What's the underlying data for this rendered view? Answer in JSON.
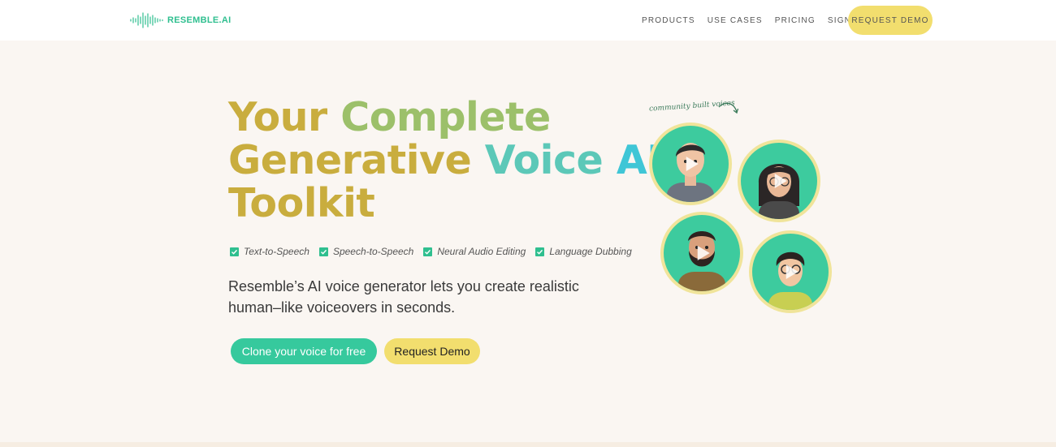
{
  "nav": {
    "logo_text": "RESEMBLE.AI",
    "links": [
      "PRODUCTS",
      "USE CASES",
      "PRICING",
      "SIGN IN"
    ],
    "cta": "REQUEST DEMO"
  },
  "hero": {
    "title_line1_a": "Your",
    "title_line1_b": "Complete",
    "title_line2_a": "Generative",
    "title_line2_b": "Voice",
    "title_line2_c": "AI",
    "title_line3": "Toolkit",
    "features": [
      "Text-to-Speech",
      "Speech-to-Speech",
      "Neural Audio Editing",
      "Language Dubbing"
    ],
    "subtitle": "Resemble’s AI voice generator lets you create realistic human–like voiceovers in seconds.",
    "primary_button": "Clone your voice for free",
    "secondary_button": "Request Demo"
  },
  "community": {
    "caption": "community built voices"
  },
  "colors": {
    "accent_green": "#36c99d",
    "accent_yellow": "#f2de6e",
    "title_gold": "#c9ad3e",
    "title_teal": "#3fc6d6",
    "background": "#faf6f2"
  },
  "icons": [
    "waveform-logo-icon",
    "check-icon",
    "play-icon",
    "curved-arrow-icon"
  ]
}
